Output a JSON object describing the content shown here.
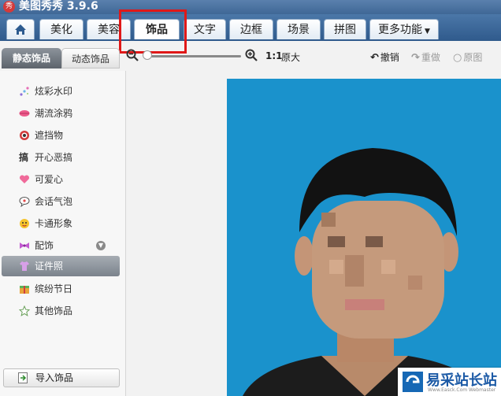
{
  "app": {
    "title": "美图秀秀 3.9.6",
    "logo_text": "秀"
  },
  "tabs": [
    {
      "label": "美化"
    },
    {
      "label": "美容"
    },
    {
      "label": "饰品",
      "active": true
    },
    {
      "label": "文字"
    },
    {
      "label": "边框"
    },
    {
      "label": "场景"
    },
    {
      "label": "拼图"
    },
    {
      "label": "更多功能"
    }
  ],
  "subtabs": {
    "static": "静态饰品",
    "dynamic": "动态饰品"
  },
  "zoom": {
    "one_to_one": "1:1",
    "original_size": "原大"
  },
  "actions": {
    "undo": "撤销",
    "redo": "重做",
    "original": "原图"
  },
  "categories": [
    {
      "label": "炫彩水印",
      "icon": "sparkle-icon"
    },
    {
      "label": "潮流涂鸦",
      "icon": "lips-icon"
    },
    {
      "label": "遮挡物",
      "icon": "mask-icon"
    },
    {
      "label": "开心恶搞",
      "icon": "prank-icon"
    },
    {
      "label": "可爱心",
      "icon": "heart-icon"
    },
    {
      "label": "会话气泡",
      "icon": "speech-bubble-icon"
    },
    {
      "label": "卡通形象",
      "icon": "cartoon-face-icon"
    },
    {
      "label": "配饰",
      "icon": "bow-icon"
    },
    {
      "label": "证件照",
      "icon": "shirt-icon",
      "selected": true
    },
    {
      "label": "缤纷节日",
      "icon": "gift-icon"
    },
    {
      "label": "其他饰品",
      "icon": "star-icon"
    }
  ],
  "import_button": "导入饰品",
  "watermark": {
    "name": "易采站长站",
    "url": "Www.Easck.Com Webmaster"
  },
  "colors": {
    "accent_red": "#e01818",
    "photo_bg": "#1a92cc",
    "tabbar": "#3a6698"
  }
}
